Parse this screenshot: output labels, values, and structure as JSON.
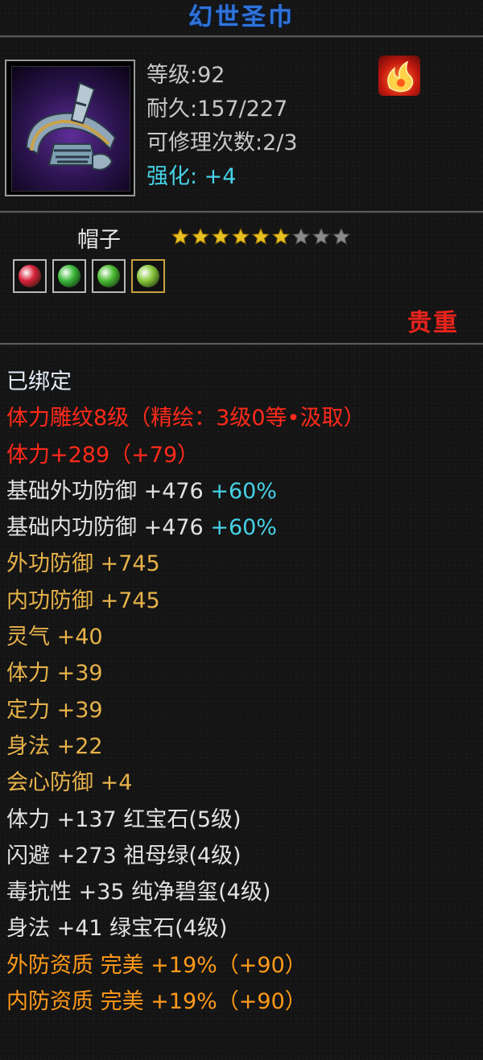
{
  "item_name": "幻世圣巾",
  "info": {
    "level": "等级:92",
    "durability": "耐久:157/227",
    "repair": "可修理次数:2/3",
    "enhance": "强化: +4"
  },
  "item_type": "帽子",
  "stars": {
    "filled": 6,
    "total": 9
  },
  "gems": [
    {
      "name": "red-gem-icon",
      "color": "#d8223a"
    },
    {
      "name": "green-gem-icon",
      "color": "#3cb83a"
    },
    {
      "name": "green-gem-icon",
      "color": "#4cbc34"
    },
    {
      "name": "green-gem-icon",
      "color": "#8ac83a"
    }
  ],
  "rarity": "贵重",
  "attributes": {
    "bound": "已绑定",
    "engrave": "体力雕纹8级（精绘：3级0等•汲取）",
    "stamina_main": "体力+289（+79）",
    "base_outer_def": "基础外功防御 +476",
    "base_outer_def_pct": " +60%",
    "base_inner_def": "基础内功防御 +476",
    "base_inner_def_pct": " +60%",
    "outer_def": "外功防御 +745",
    "inner_def": "内功防御 +745",
    "spirit": "灵气 +40",
    "stamina": "体力 +39",
    "focus": "定力 +39",
    "agility": "身法 +22",
    "crit_def": "会心防御 +4",
    "gem_stamina": "体力 +137 红宝石(5级)",
    "gem_dodge": "闪避 +273 祖母绿(4级)",
    "gem_poison": "毒抗性 +35 纯净碧玺(4级)",
    "gem_agility": "身法 +41 绿宝石(4级)",
    "outer_quality": "外防资质  完美 +19%（+90）",
    "inner_quality": "内防资质  完美 +19%（+90）"
  },
  "colors": {
    "title": "#2f73d8",
    "red": "#ff2a1a",
    "gold": "#e6b24a",
    "orange": "#ff9a1a",
    "cyan": "#46d2e6"
  }
}
